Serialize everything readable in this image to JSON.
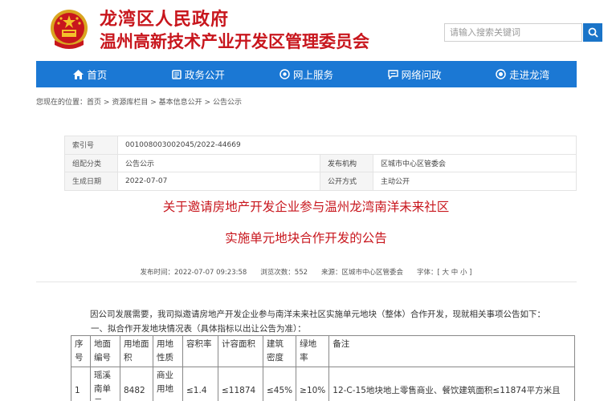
{
  "header": {
    "title_line1": "龙湾区人民政府",
    "title_line2": "温州高新技术产业开发区管理委员会"
  },
  "search": {
    "placeholder": "请输入搜索关键词"
  },
  "nav": {
    "items": [
      {
        "label": "首页",
        "icon": "home-icon"
      },
      {
        "label": "政务公开",
        "icon": "document-icon"
      },
      {
        "label": "网上服务",
        "icon": "service-icon"
      },
      {
        "label": "网络问政",
        "icon": "chat-icon"
      },
      {
        "label": "走进龙湾",
        "icon": "eye-icon"
      }
    ]
  },
  "breadcrumb": {
    "prefix": "您现在的位置：",
    "items": [
      "首页",
      "资源库栏目",
      "基本信息公开",
      "公告公示"
    ],
    "separator": ">"
  },
  "meta": {
    "index_label": "索引号",
    "index_value": "001008003002045/2022-44669",
    "category_label": "组配分类",
    "category_value": "公告公示",
    "issuer_label": "发布机构",
    "issuer_value": "区城市中心区管委会",
    "date_label": "生成日期",
    "date_value": "2022-07-07",
    "mode_label": "公开方式",
    "mode_value": "主动公开"
  },
  "article": {
    "title_line1": "关于邀请房地产开发企业参与温州龙湾南洋未来社区",
    "title_line2": "实施单元地块合作开发的公告",
    "publish_info": "发布时间：2022-07-07 09:23:58　　浏览次数：552　　来源：区城市中心区管委会　　字体：[ 大  中  小 ]",
    "para1": "因公司发展需要，我司拟邀请房地产开发企业参与南洋未来社区实施单元地块（整体）合作开发，现就相关事项公告如下：",
    "para2": "一、拟合作开发地块情况表（具体指标以出让公告为准）："
  },
  "table": {
    "headers": [
      "序\n号",
      "地面\n编号",
      "用地面\n积",
      "用地\n性质",
      "容积率",
      "计容面积",
      "建筑\n密度",
      "绿地\n率",
      "备注"
    ],
    "rows": [
      [
        "1",
        "瑶溪\n南单\n元",
        "8482",
        "商业\n用地",
        "≤1.4",
        "≤11874",
        "≤45%",
        "≥10%",
        "12-C-15地块地上零售商业、餐饮建筑面积≤11874平方米且"
      ]
    ]
  },
  "colors": {
    "brand_red": "#c8161d",
    "nav_blue": "#1b78d4"
  }
}
